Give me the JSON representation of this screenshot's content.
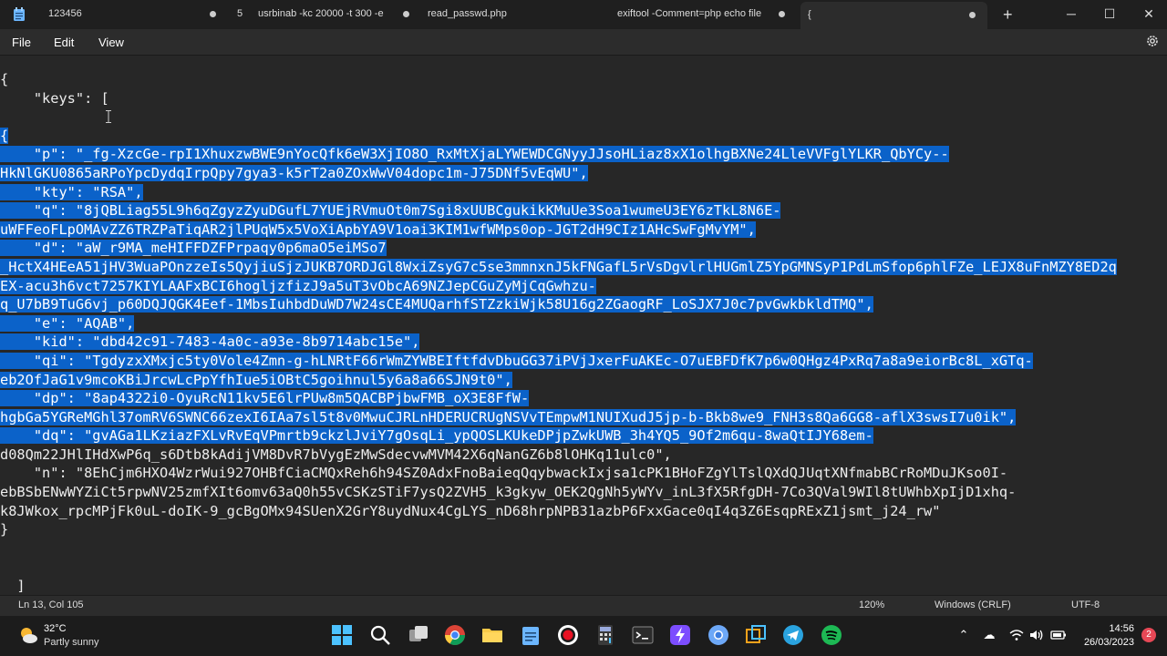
{
  "tabs": [
    {
      "label": "123456"
    },
    {
      "label": "5"
    },
    {
      "label": "usrbinab -kc 20000 -t 300 -e"
    },
    {
      "label": "read_passwd.php"
    },
    {
      "label": "exiftool -Comment=php echo file"
    },
    {
      "label": "{"
    }
  ],
  "window": {
    "new_tab": "+",
    "minimize": "─",
    "maximize": "☐",
    "close": "✕"
  },
  "menu": {
    "file": "File",
    "edit": "Edit",
    "view": "View"
  },
  "editor": {
    "lines": [
      {
        "text": "{",
        "selected": false
      },
      {
        "text": "    \"keys\": [",
        "selected": false
      },
      {
        "text": "",
        "selected": false
      },
      {
        "text": "{",
        "selected": true
      },
      {
        "text": "    \"p\": \"_fg-XzcGe-rpI1XhuxzwBWE9nYocQfk6eW3XjIO8O_RxMtXjaLYWEWDCGNyyJJsoHLiaz8xX1olhgBXNe24LleVVFglYLKR_QbYCy--",
        "selected": true
      },
      {
        "text": "HkNlGKU0865aRPoYpcDydqIrpQpy7gya3-k5rT2a0ZOxWwV04dopc1m-J75DNf5vEqWU\",",
        "selected": true
      },
      {
        "text": "    \"kty\": \"RSA\",",
        "selected": true
      },
      {
        "text": "    \"q\": \"8jQBLiag55L9h6qZgyzZyuDGufL7YUEjRVmuOt0m7Sgi8xUUBCgukikKMuUe3Soa1wumeU3EY6zTkL8N6E-",
        "selected": true
      },
      {
        "text": "uWFFeoFLpOMAvZZ6TRZPaTiqAR2jlPUqW5x5VoXiApbYA9V1oai3KIM1wfWMps0op-JGT2dH9CIz1AHcSwFgMvYM\",",
        "selected": true
      },
      {
        "text": "    \"d\": \"aW_r9MA_meHIFFDZFPrpaqy0p6maO5eiMSo7",
        "selected": true
      },
      {
        "text": "_HctX4HEeA51jHV3WuaPOnzzeIs5QyjiuSjzJUKB7ORDJGl8WxiZsyG7c5se3mmnxnJ5kFNGafL5rVsDgvlrlHUGmlZ5YpGMNSyP1PdLmSfop6phlFZe_LEJX8uFnMZY8ED2q",
        "selected": true
      },
      {
        "text": "EX-acu3h6vct7257KIYLAAFxBCI6hogljzfizJ9a5uT3vObcA69NZJepCGuZyMjCqGwhzu-",
        "selected": true
      },
      {
        "text": "q_U7bB9TuG6vj_p60DQJQGK4Eef-1MbsIuhbdDuWD7W24sCE4MUQarhfSTZzkiWjk58U16g2ZGaogRF_LoSJX7J0c7pvGwkbkldTMQ\",",
        "selected": true
      },
      {
        "text": "    \"e\": \"AQAB\",",
        "selected": true
      },
      {
        "text": "    \"kid\": \"dbd42c91-7483-4a0c-a93e-8b9714abc15e\",",
        "selected": true
      },
      {
        "text": "    \"qi\": \"TgdyzxXMxjc5ty0Vole4Zmn-g-hLNRtF66rWmZYWBEIftfdvDbuGG37iPVjJxerFuAKEc-O7uEBFDfK7p6w0QHgz4PxRq7a8a9eiorBc8L_xGTq-",
        "selected": true
      },
      {
        "text": "eb2OfJaG1v9mcoKBiJrcwLcPpYfhIue5iOBtC5goihnul5y6a8a66SJN9t0\",",
        "selected": true
      },
      {
        "text": "    \"dp\": \"8ap4322i0-OyuRcN11kv5E6lrPUw8m5QACBPjbwFMB_oX3E8FfW-",
        "selected": true
      },
      {
        "text": "hgbGa5YGReMGhl37omRV6SWNC66zexI6IAa7sl5t8v0MwuCJRLnHDERUCRUgNSVvTEmpwM1NUIXudJ5jp-b-Bkb8we9_FNH3s8Qa6GG8-aflX3swsI7u0ik\",",
        "selected": true
      },
      {
        "text": "    \"dq\": \"gvAGa1LKziazFXLvRvEqVPmrtb9ckzlJviY7gOsqLi_ypQOSLKUkeDPjpZwkUWB_3h4YQ5_9Of2m6qu-8waQtIJY68em-",
        "selected": true
      },
      {
        "text": "d08Qm22JHlIHdXwP6q_s6Dtb8kAdijVM8DvR7bVygEzMwSdecvwMVM42X6qNanGZ6b8lOHKq11ulc0\",",
        "selected": false
      },
      {
        "text": "    \"n\": \"8EhCjm6HXO4WzrWui927OHBfCiaCMQxReh6h94SZ0AdxFnoBaieqQqybwackIxjsa1cPK1BHoFZgYlTslQXdQJUqtXNfmabBCrRoMDuJKso0I-",
        "selected": false
      },
      {
        "text": "ebBSbENwWYZiCt5rpwNV25zmfXIt6omv63aQ0h55vCSKzSTiF7ysQ2ZVH5_k3gkyw_OEK2QgNh5yWYv_inL3fX5RfgDH-7Co3QVal9WIl8tUWhbXpIjD1xhq-",
        "selected": false
      },
      {
        "text": "k8JWkox_rpcMPjFk0uL-doIK-9_gcBgOMx94SUenX2GrY8uydNux4CgLYS_nD68hrpNPB31azbP6FxxGace0qI4q3Z6EsqpRExZ1jsmt_j24_rw\"",
        "selected": false
      },
      {
        "text": "}",
        "selected": false
      },
      {
        "text": "",
        "selected": false
      },
      {
        "text": "",
        "selected": false
      },
      {
        "text": "  ]",
        "selected": false
      }
    ]
  },
  "status": {
    "position": "Ln 13, Col 105",
    "zoom": "120%",
    "line_ending": "Windows (CRLF)",
    "encoding": "UTF-8"
  },
  "taskbar": {
    "weather_temp": "32°C",
    "weather_desc": "Partly sunny",
    "time": "14:56",
    "date": "26/03/2023",
    "notifications": "2"
  },
  "colors": {
    "selection": "#0b62c9",
    "editor_bg": "#272727",
    "accent": "#7ab8f5"
  }
}
